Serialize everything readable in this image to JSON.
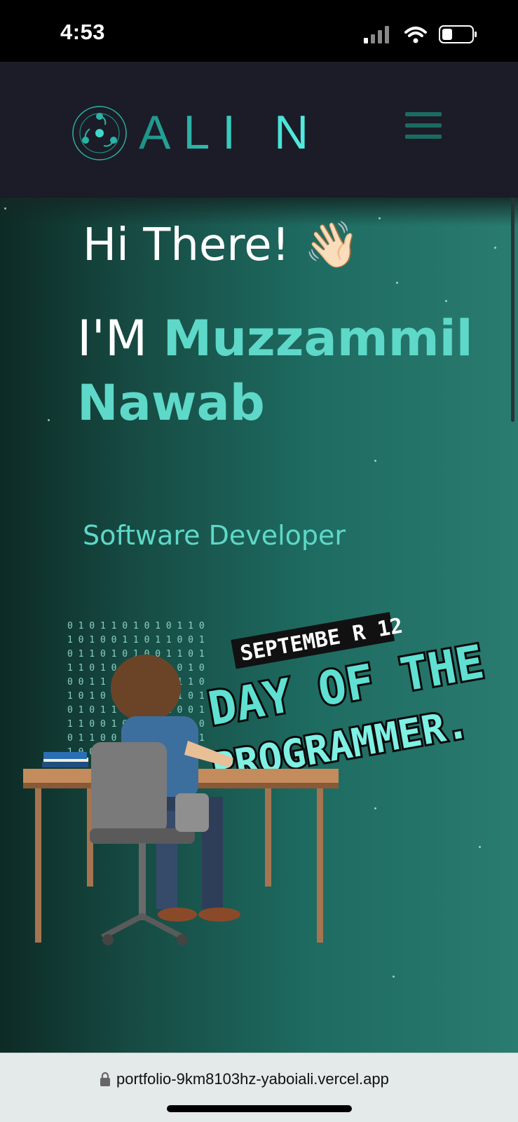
{
  "status_bar": {
    "time": "4:53",
    "icons": [
      "signal-icon",
      "wifi-icon",
      "battery-icon"
    ]
  },
  "nav": {
    "logo_text": "ALI N",
    "menu_icon": "hamburger-icon"
  },
  "hero": {
    "greeting": "Hi There!",
    "wave_emoji": "👋🏻",
    "name_prefix": "I'M ",
    "name_first": "Muzzammil",
    "name_last": "Nawab",
    "role": "Software Developer",
    "illustration": {
      "banner_date": "SEPTEMBE R 12",
      "banner_line1": "DAY OF THE",
      "banner_line2": "PROGRAMMER."
    }
  },
  "browser": {
    "url": "portfolio-9km8103hz-yaboiali.vercel.app"
  },
  "colors": {
    "accent": "#5ed8c8",
    "nav_bg": "#1b1c27",
    "hero_dark": "#0d2a25",
    "hero_light": "#2a7b70"
  }
}
